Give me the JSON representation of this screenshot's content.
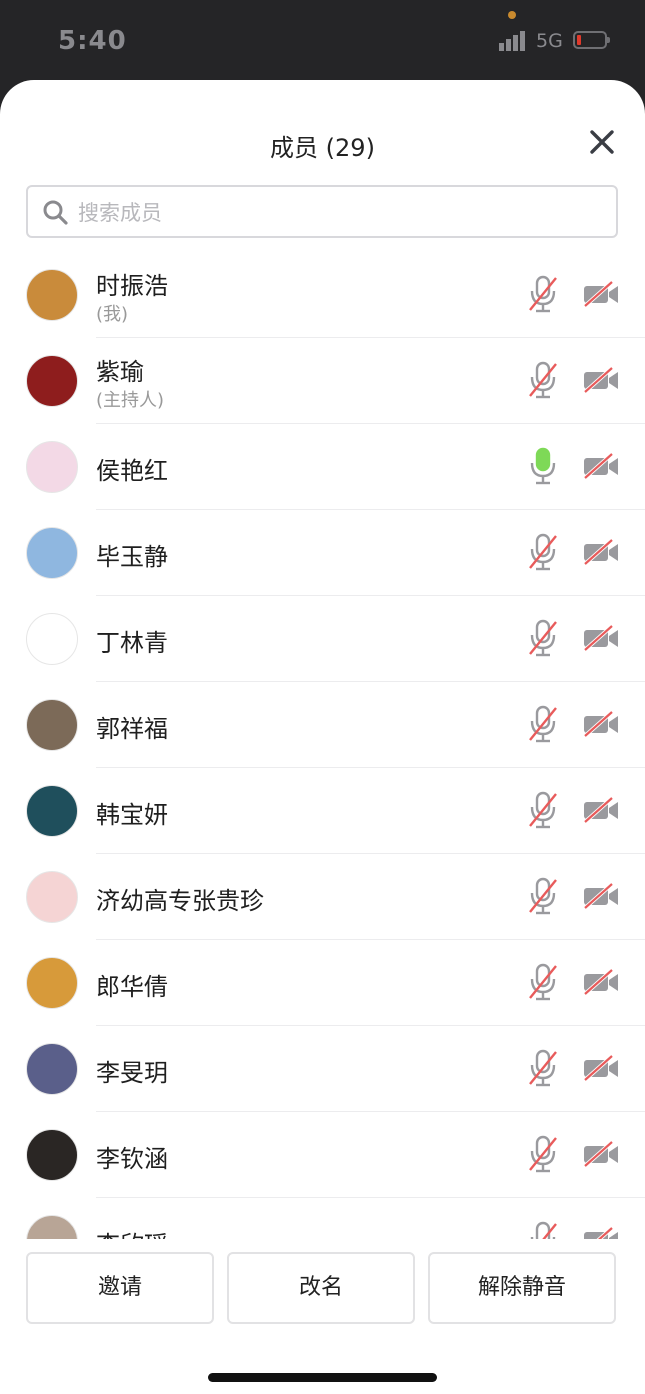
{
  "status": {
    "time": "5:40",
    "network": "5G"
  },
  "header": {
    "title": "成员 (29)"
  },
  "search": {
    "placeholder": "搜索成员"
  },
  "members": [
    {
      "name": "时振浩",
      "tag": "(我)",
      "mic": "muted",
      "video": "off",
      "avatar_color": "#c98b3b"
    },
    {
      "name": "紫瑜",
      "tag": "(主持人)",
      "mic": "muted",
      "video": "off",
      "avatar_color": "#8e1d1d"
    },
    {
      "name": "侯艳红",
      "tag": "",
      "mic": "active",
      "video": "off",
      "avatar_color": "#f3d9e6"
    },
    {
      "name": "毕玉静",
      "tag": "",
      "mic": "muted",
      "video": "off",
      "avatar_color": "#8fb7e0"
    },
    {
      "name": "丁林青",
      "tag": "",
      "mic": "muted",
      "video": "off",
      "avatar_color": "#ffffff"
    },
    {
      "name": "郭祥福",
      "tag": "",
      "mic": "muted",
      "video": "off",
      "avatar_color": "#7c6a58"
    },
    {
      "name": "韩宝妍",
      "tag": "",
      "mic": "muted",
      "video": "off",
      "avatar_color": "#1f4f5c"
    },
    {
      "name": "济幼高专张贵珍",
      "tag": "",
      "mic": "muted",
      "video": "off",
      "avatar_color": "#f5d4d4"
    },
    {
      "name": "郎华倩",
      "tag": "",
      "mic": "muted",
      "video": "off",
      "avatar_color": "#d79a3a"
    },
    {
      "name": "李旻玥",
      "tag": "",
      "mic": "muted",
      "video": "off",
      "avatar_color": "#5a5f8a"
    },
    {
      "name": "李钦涵",
      "tag": "",
      "mic": "muted",
      "video": "off",
      "avatar_color": "#2a2624"
    },
    {
      "name": "李欣瑶",
      "tag": "",
      "mic": "muted",
      "video": "off",
      "avatar_color": "#b8a596"
    }
  ],
  "actions": {
    "invite": "邀请",
    "rename": "改名",
    "unmute": "解除静音"
  },
  "colors": {
    "muted_slash": "#e85b5b",
    "mic_active": "#7ed957",
    "icon_gray": "#9a9a9e"
  }
}
